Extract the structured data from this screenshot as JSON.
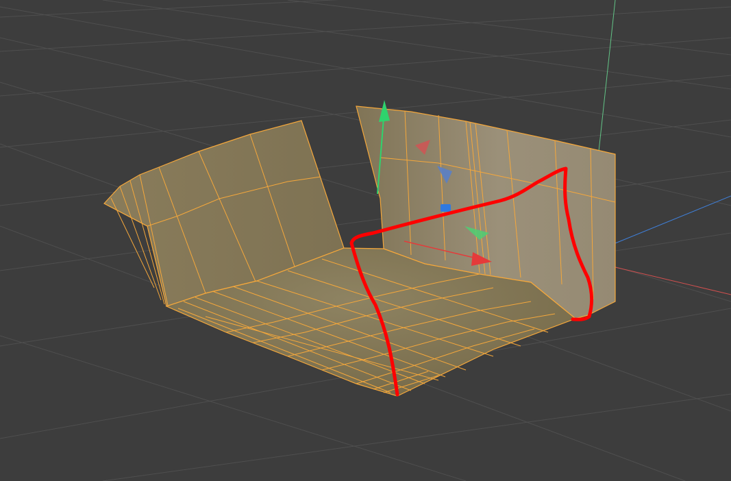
{
  "viewport": {
    "background_color": "#3d3d3d",
    "grid_color": "#4f4f4f",
    "axis_colors": {
      "x": "#d2504f",
      "y": "#63c587",
      "z": "#3f7fd8"
    }
  },
  "mesh": {
    "face_color": "#8a7d5b",
    "edge_color": "#f6a83b",
    "selected": true
  },
  "gizmo": {
    "x_arrow_color": "#e53a3a",
    "y_arrow_color": "#2fd36d",
    "z_handle_color": "#2f79e0",
    "plane_handles": [
      "xz-plane-handle",
      "yz-plane-handle",
      "xy-plane-handle"
    ]
  },
  "annotation": {
    "stroke_color": "#ff0000"
  }
}
